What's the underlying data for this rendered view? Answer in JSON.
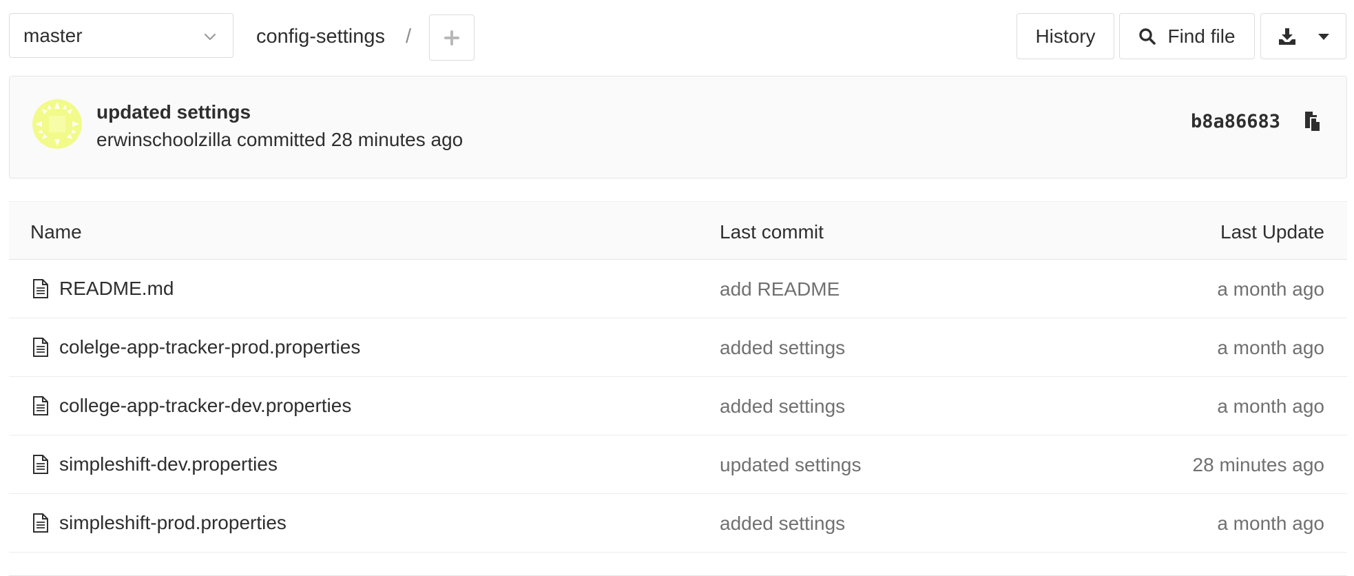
{
  "toolbar": {
    "branch": "master",
    "project": "config-settings",
    "separator": "/",
    "history_label": "History",
    "find_file_label": "Find file"
  },
  "commit": {
    "title": "updated settings",
    "author": "erwinschoolzilla",
    "meta": "erwinschoolzilla committed 28 minutes ago",
    "sha": "b8a86683",
    "avatar_color": "#f2fa8a"
  },
  "table": {
    "headers": {
      "name": "Name",
      "last_commit": "Last commit",
      "last_update": "Last Update"
    },
    "rows": [
      {
        "name": "README.md",
        "commit": "add README",
        "updated": "a month ago"
      },
      {
        "name": "colelge-app-tracker-prod.properties",
        "commit": "added settings",
        "updated": "a month ago"
      },
      {
        "name": "college-app-tracker-dev.properties",
        "commit": "added settings",
        "updated": "a month ago"
      },
      {
        "name": "simpleshift-dev.properties",
        "commit": "updated settings",
        "updated": "28 minutes ago"
      },
      {
        "name": "simpleshift-prod.properties",
        "commit": "added settings",
        "updated": "a month ago"
      }
    ]
  },
  "icons": {
    "chevron": "chevron-down-icon",
    "plus": "plus-icon",
    "search": "search-icon",
    "download": "download-icon",
    "caret": "caret-down-icon",
    "copy": "clipboard-icon",
    "file": "file-text-icon"
  }
}
